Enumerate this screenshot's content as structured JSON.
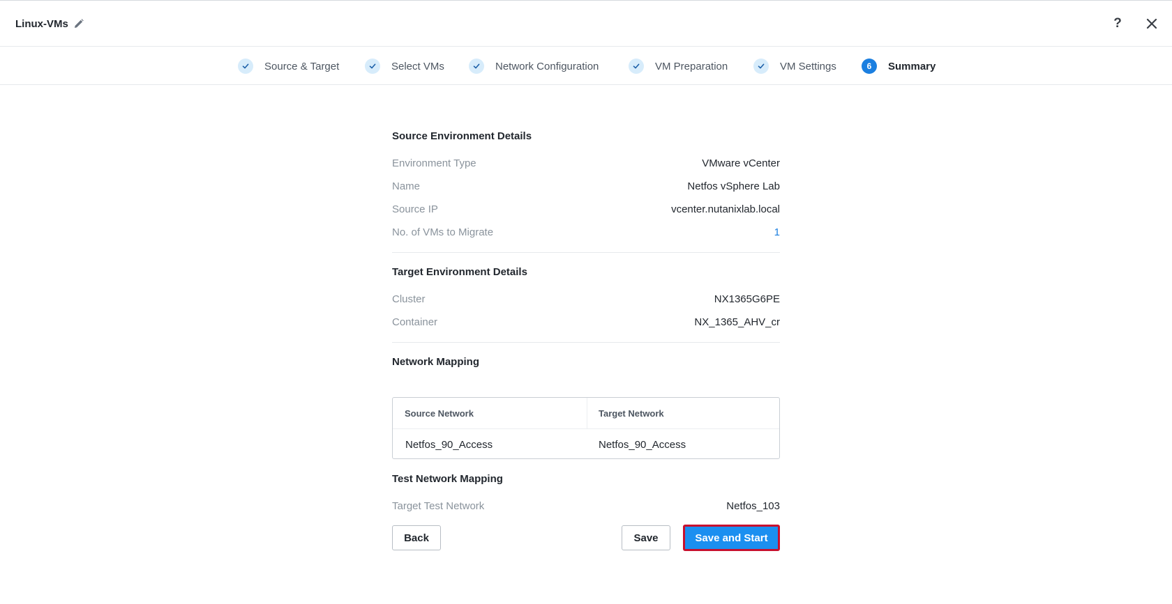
{
  "header": {
    "title": "Linux-VMs",
    "help_label": "?"
  },
  "steps": [
    {
      "label": "Source & Target",
      "state": "done"
    },
    {
      "label": "Select VMs",
      "state": "done"
    },
    {
      "label": "Network Configuration",
      "state": "done"
    },
    {
      "label": "VM Preparation",
      "state": "done"
    },
    {
      "label": "VM Settings",
      "state": "done"
    },
    {
      "label": "Summary",
      "state": "active",
      "number": "6"
    }
  ],
  "source": {
    "title": "Source Environment Details",
    "rows": [
      {
        "label": "Environment Type",
        "value": "VMware vCenter"
      },
      {
        "label": "Name",
        "value": "Netfos vSphere Lab"
      },
      {
        "label": "Source IP",
        "value": "vcenter.nutanixlab.local"
      },
      {
        "label": "No. of VMs to Migrate",
        "value": "1"
      }
    ]
  },
  "target": {
    "title": "Target Environment Details",
    "rows": [
      {
        "label": "Cluster",
        "value": "NX1365G6PE"
      },
      {
        "label": "Container",
        "value": "NX_1365_AHV_cr"
      }
    ]
  },
  "network_mapping": {
    "title": "Network Mapping",
    "columns": [
      "Source Network",
      "Target Network"
    ],
    "rows": [
      [
        "Netfos_90_Access",
        "Netfos_90_Access"
      ]
    ]
  },
  "test_network": {
    "title": "Test Network Mapping",
    "rows": [
      {
        "label": "Target Test Network",
        "value": "Netfos_103"
      }
    ]
  },
  "buttons": {
    "back": "Back",
    "save": "Save",
    "save_and_start": "Save and Start"
  },
  "colors": {
    "accent": "#1b8ff0",
    "highlight_border": "#c8102e"
  }
}
